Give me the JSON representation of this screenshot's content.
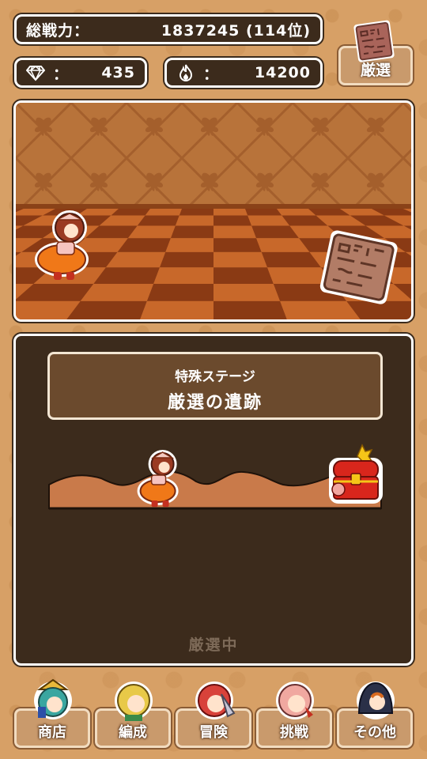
{
  "header": {
    "power_label": "総戦力：",
    "power_value": "1837245 (114位)",
    "gems_label": "：",
    "gems_value": "435",
    "fire_label": "：",
    "fire_value": "14200",
    "gensen_button": "厳選"
  },
  "stage": {
    "subtitle": "特殊ステージ",
    "title": "厳選の遺跡",
    "status": "厳選中",
    "progress": 0.36
  },
  "nav": {
    "shop": "商店",
    "formation": "編成",
    "adventure": "冒険",
    "challenge": "挑戦",
    "other": "その他"
  },
  "icons": {
    "gem": "diamond-icon",
    "fire": "flame-icon",
    "tablet": "stone-tablet-icon",
    "chest": "treasure-chest-icon"
  },
  "colors": {
    "panel_dark": "#3c2b1c",
    "background": "#d7a066",
    "button": "#c99a6c"
  }
}
